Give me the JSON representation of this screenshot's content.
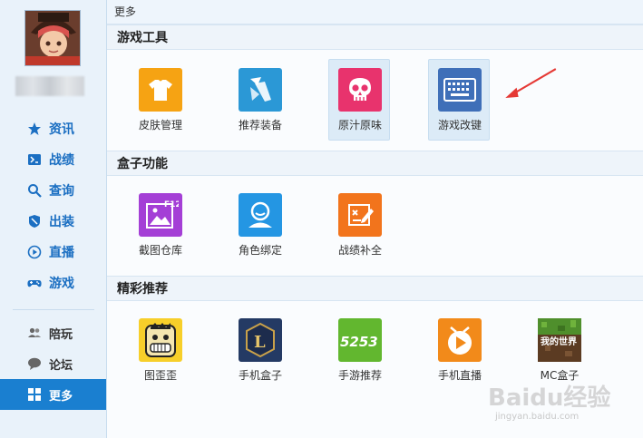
{
  "sidebar": {
    "nav": [
      {
        "label": "资讯",
        "icon": "star-icon"
      },
      {
        "label": "战绩",
        "icon": "record-icon"
      },
      {
        "label": "查询",
        "icon": "search-icon"
      },
      {
        "label": "出装",
        "icon": "equipment-icon"
      },
      {
        "label": "直播",
        "icon": "play-icon"
      },
      {
        "label": "游戏",
        "icon": "gamepad-icon"
      }
    ],
    "secondary": [
      {
        "label": "陪玩",
        "icon": "people-icon"
      },
      {
        "label": "论坛",
        "icon": "chat-icon"
      },
      {
        "label": "更多",
        "icon": "grid-icon",
        "active": true
      }
    ]
  },
  "breadcrumb": "更多",
  "sections": [
    {
      "title": "游戏工具",
      "items": [
        {
          "label": "皮肤管理",
          "icon": "shirt-icon",
          "color": "#f6a313"
        },
        {
          "label": "推荐装备",
          "icon": "recommend-gear-icon",
          "color": "#2b98d6"
        },
        {
          "label": "原汁原味",
          "icon": "skull-icon",
          "color": "#e8336d"
        },
        {
          "label": "游戏改键",
          "icon": "keyboard-icon",
          "color": "#3f6fb8"
        }
      ]
    },
    {
      "title": "盒子功能",
      "items": [
        {
          "label": "截图仓库",
          "icon": "screenshot-icon",
          "color": "#a43fd6",
          "badge": "F12"
        },
        {
          "label": "角色绑定",
          "icon": "user-bind-icon",
          "color": "#2496e3"
        },
        {
          "label": "战绩补全",
          "icon": "record-edit-icon",
          "color": "#f2741c"
        }
      ]
    },
    {
      "title": "精彩推荐",
      "items": [
        {
          "label": "图歪歪",
          "icon": "tuwaiwai-icon",
          "color": "#f7cf2a"
        },
        {
          "label": "手机盒子",
          "icon": "mobile-box-icon",
          "color": "#243a64",
          "badge": "L"
        },
        {
          "label": "手游推荐",
          "icon": "mobile-game-icon",
          "color": "#62b72f",
          "badge": "5253"
        },
        {
          "label": "手机直播",
          "icon": "mobile-live-icon",
          "color": "#f28a1a"
        },
        {
          "label": "MC盒子",
          "icon": "mc-box-icon",
          "color": "#4f7a2c",
          "badge": "我的世界"
        }
      ]
    }
  ],
  "watermark": {
    "brand": "Baidu经验",
    "url": "jingyan.baidu.com"
  }
}
